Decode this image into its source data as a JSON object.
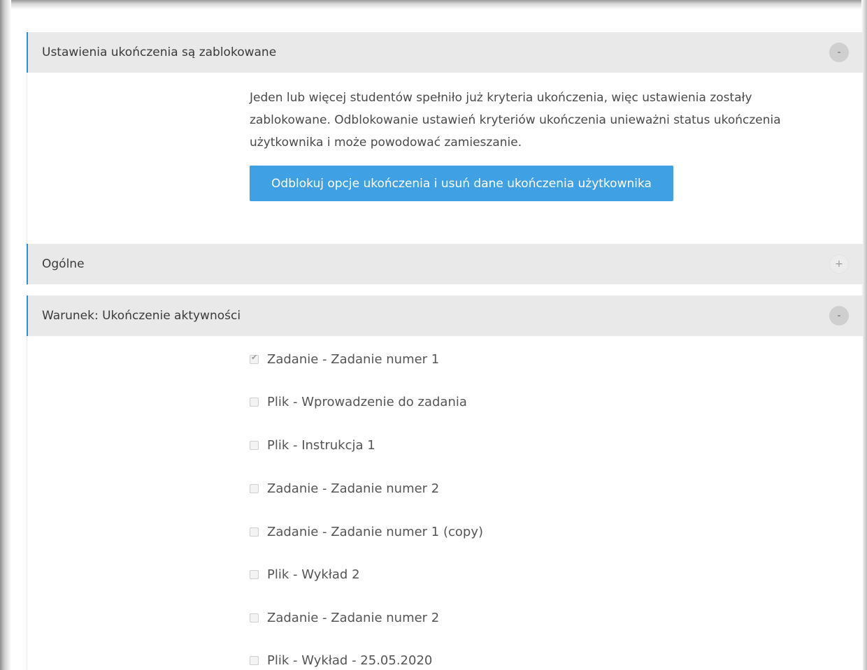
{
  "locked_section": {
    "title": "Ustawienia ukończenia są zablokowane",
    "toggle": "-",
    "message": "Jeden lub więcej studentów spełniło już kryteria ukończenia, więc ustawienia zostały zablokowane. Odblokowanie ustawień kryteriów ukończenia unieważni status ukończenia użytkownika i może powodować zamieszanie.",
    "unlock_button": "Odblokuj opcje ukończenia i usuń dane ukończenia użytkownika"
  },
  "general_section": {
    "title": "Ogólne",
    "toggle": "+"
  },
  "condition_section": {
    "title": "Warunek: Ukończenie aktywności",
    "toggle": "-",
    "activities": [
      {
        "label": "Zadanie - Zadanie numer 1",
        "checked": true
      },
      {
        "label": "Plik - Wprowadzenie do zadania",
        "checked": false
      },
      {
        "label": "Plik - Instrukcja 1",
        "checked": false
      },
      {
        "label": "Zadanie - Zadanie numer 2",
        "checked": false
      },
      {
        "label": "Zadanie - Zadanie numer 1 (copy)",
        "checked": false
      },
      {
        "label": "Plik - Wykład 2",
        "checked": false
      },
      {
        "label": "Zadanie - Zadanie numer 2",
        "checked": false
      },
      {
        "label": "Plik - Wykład - 25.05.2020",
        "checked": false
      }
    ]
  },
  "colors": {
    "accent": "#3fa1e3",
    "header_bg": "#e9e9e9",
    "header_border": "#2f8fd6"
  }
}
